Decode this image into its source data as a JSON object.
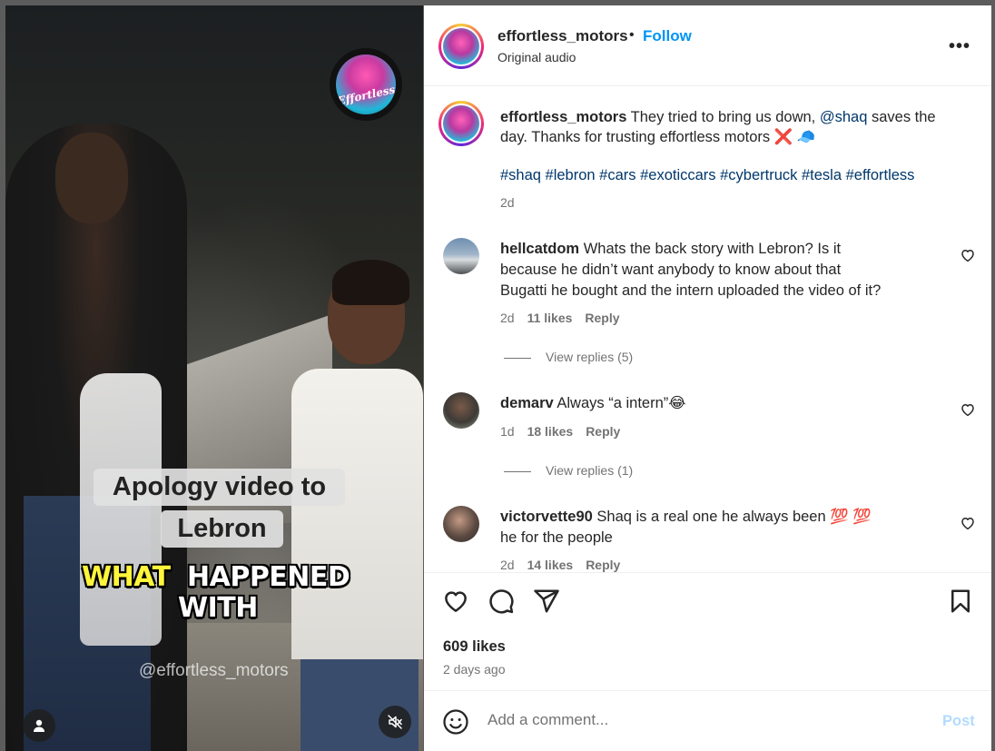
{
  "media": {
    "caption_line1": "Apology video to",
    "caption_line2": "Lebron",
    "overlay_word_yellow": "WHAT",
    "overlay_word_white": "HAPPENED",
    "overlay_line2": "WITH",
    "watermark": "@effortless_motors",
    "logo_text": "Effortless"
  },
  "header": {
    "username": "effortless_motors",
    "separator": "•",
    "follow_label": "Follow",
    "subtitle": "Original audio",
    "more_label": "•••"
  },
  "caption": {
    "username": "effortless_motors",
    "text_before": " They tried to bring us down, ",
    "mention": "@shaq",
    "text_after": " saves the day. Thanks for trusting effortless motors ❌ 🧢",
    "hashtags": "#shaq #lebron #cars #exoticcars #cybertruck #tesla #effortless",
    "time": "2d"
  },
  "comments": [
    {
      "username": "hellcatdom",
      "text": " Whats the back story with Lebron? Is it because he didn’t want anybody to know about that Bugatti he bought and the intern uploaded the video of it?",
      "time": "2d",
      "likes": "11 likes",
      "reply": "Reply",
      "view_replies": "View replies (5)"
    },
    {
      "username": "demarv",
      "text": " Always “a intern”😂",
      "time": "1d",
      "likes": "18 likes",
      "reply": "Reply",
      "view_replies": "View replies (1)"
    },
    {
      "username": "victorvette90",
      "text": " Shaq is a real one he always been 💯 💯  he for the people",
      "time": "2d",
      "likes": "14 likes",
      "reply": "Reply"
    }
  ],
  "footer": {
    "likes": "609 likes",
    "posted": "2 days ago",
    "comment_placeholder": "Add a comment...",
    "post_label": "Post"
  },
  "colors": {
    "accent": "#0095f6",
    "link": "#00376b",
    "muted": "#737373",
    "post_disabled": "#b3dbff"
  }
}
